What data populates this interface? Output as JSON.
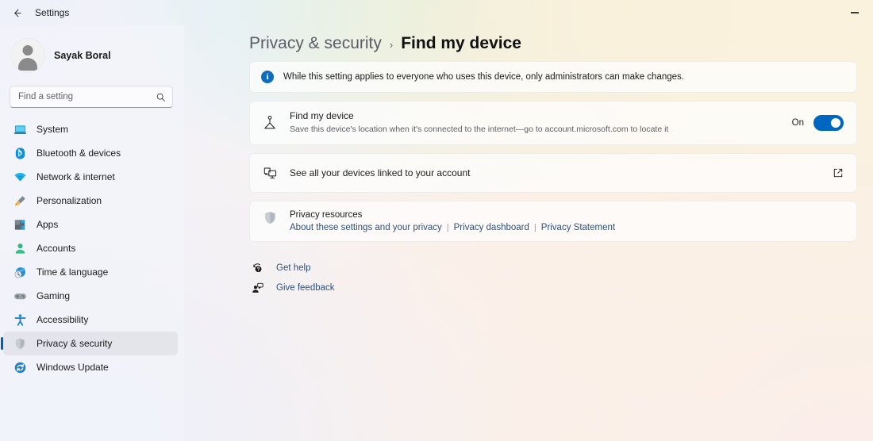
{
  "window": {
    "title": "Settings",
    "back_icon": "back-arrow-icon",
    "minimize_label": "Minimize"
  },
  "sidebar": {
    "profile": {
      "name": "Sayak Boral",
      "avatar_icon": "avatar-icon"
    },
    "search": {
      "placeholder": "Find a setting",
      "value": "",
      "icon": "search-icon"
    },
    "items": [
      {
        "label": "System",
        "icon": "system-icon",
        "selected": false
      },
      {
        "label": "Bluetooth & devices",
        "icon": "bluetooth-icon",
        "selected": false
      },
      {
        "label": "Network & internet",
        "icon": "wifi-icon",
        "selected": false
      },
      {
        "label": "Personalization",
        "icon": "paintbrush-icon",
        "selected": false
      },
      {
        "label": "Apps",
        "icon": "apps-icon",
        "selected": false
      },
      {
        "label": "Accounts",
        "icon": "accounts-icon",
        "selected": false
      },
      {
        "label": "Time & language",
        "icon": "clock-globe-icon",
        "selected": false
      },
      {
        "label": "Gaming",
        "icon": "gamepad-icon",
        "selected": false
      },
      {
        "label": "Accessibility",
        "icon": "accessibility-icon",
        "selected": false
      },
      {
        "label": "Privacy & security",
        "icon": "shield-icon",
        "selected": true
      },
      {
        "label": "Windows Update",
        "icon": "update-icon",
        "selected": false
      }
    ]
  },
  "breadcrumb": {
    "parent": "Privacy & security",
    "separator": "›",
    "current": "Find my device"
  },
  "banner": {
    "icon": "info-icon",
    "glyph": "i",
    "text": "While this setting applies to everyone who uses this device, only administrators can make changes."
  },
  "find_my_device": {
    "icon": "locator-pin-icon",
    "title": "Find my device",
    "description": "Save this device's location when it's connected to the internet—go to account.microsoft.com to locate it",
    "toggle_state": "On",
    "toggle_on": true
  },
  "linked_devices": {
    "icon": "devices-icon",
    "title": "See all your devices linked to your account",
    "action_icon": "external-link-icon"
  },
  "privacy_resources": {
    "icon": "shield-icon",
    "title": "Privacy resources",
    "links": [
      "About these settings and your privacy",
      "Privacy dashboard",
      "Privacy Statement"
    ],
    "separator": "|"
  },
  "footer": {
    "links": [
      {
        "label": "Get help",
        "icon": "help-icon"
      },
      {
        "label": "Give feedback",
        "icon": "feedback-icon"
      }
    ]
  },
  "colors": {
    "accent": "#005fb8",
    "toggle_on": "#0067c0",
    "link": "#2f4f7a",
    "info": "#0f6cbd"
  }
}
